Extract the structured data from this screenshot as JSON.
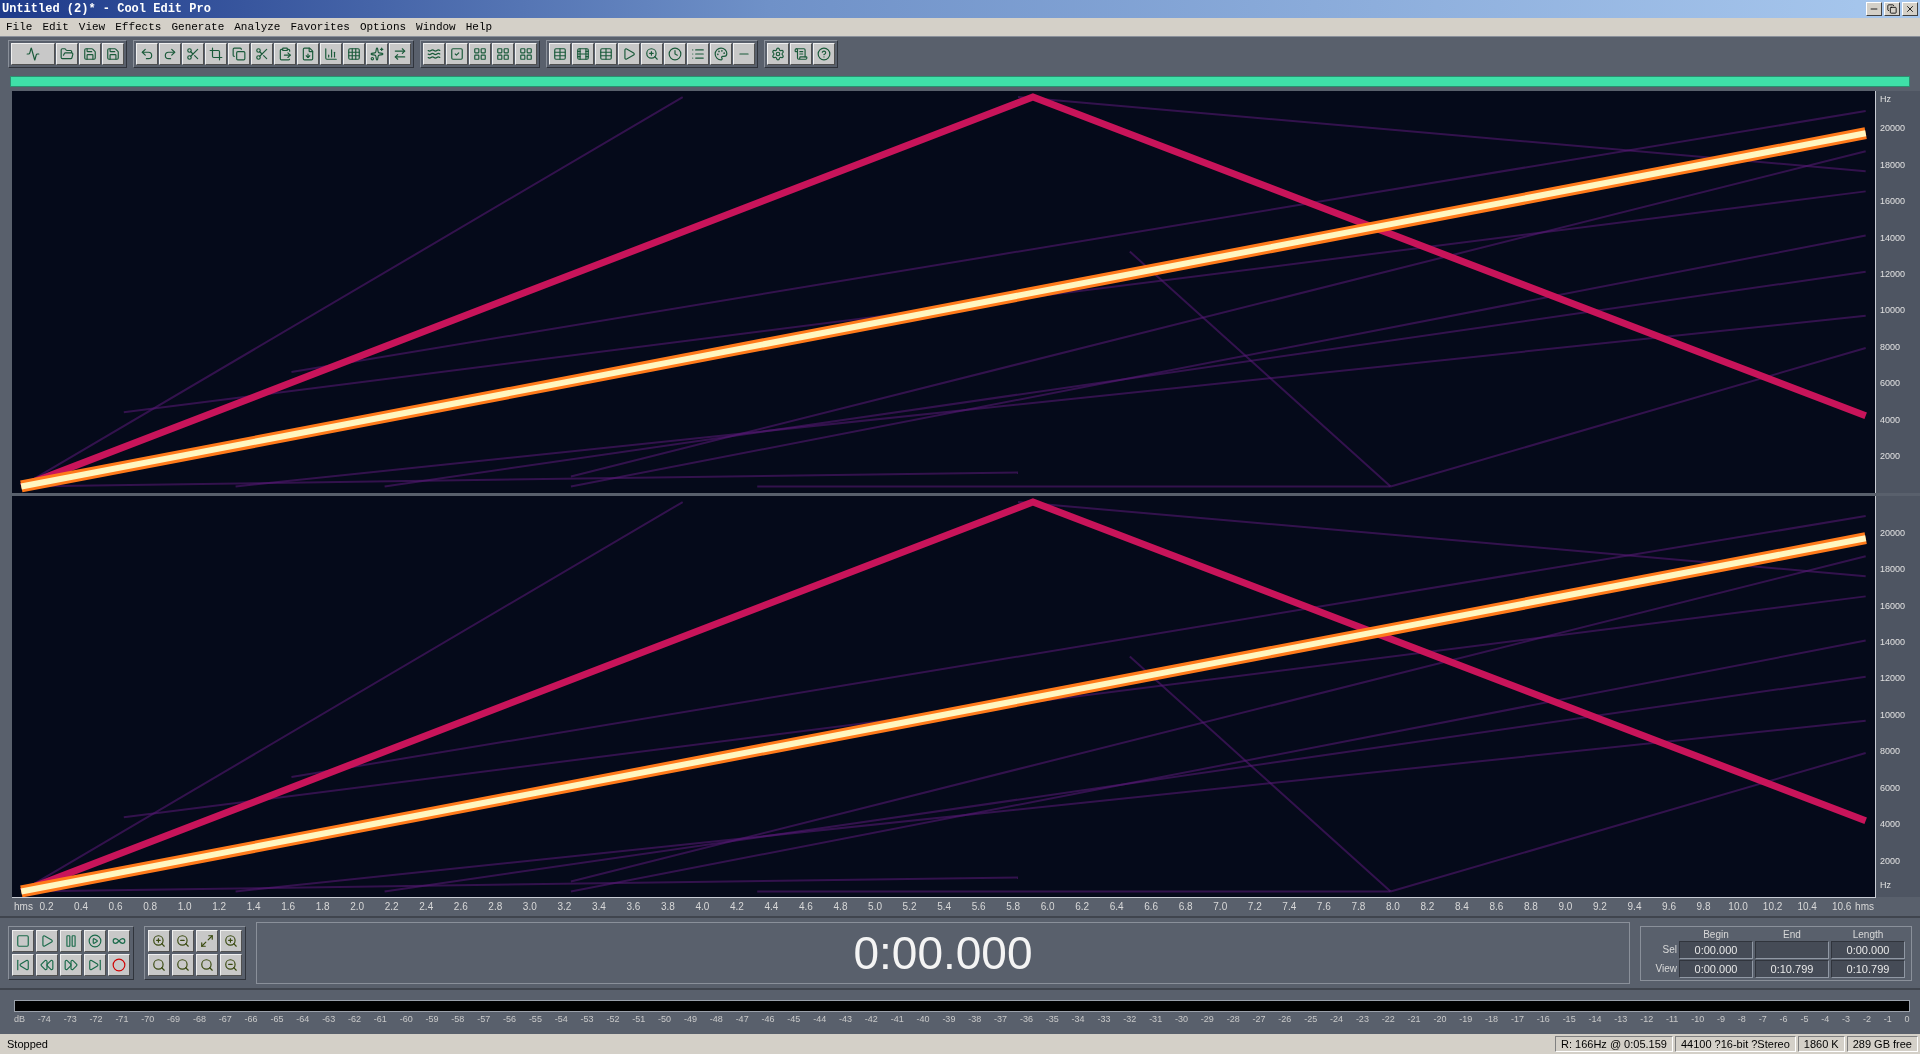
{
  "window": {
    "title": "Untitled (2)* - Cool Edit Pro"
  },
  "menu": [
    "File",
    "Edit",
    "View",
    "Effects",
    "Generate",
    "Analyze",
    "Favorites",
    "Options",
    "Window",
    "Help"
  ],
  "spectrogram": {
    "channels": [
      {
        "freq_labels": [
          {
            "kind": "unit",
            "text": "Hz"
          },
          {
            "kind": "tick",
            "text": "20000"
          },
          {
            "kind": "tick",
            "text": "18000"
          },
          {
            "kind": "tick",
            "text": "16000"
          },
          {
            "kind": "tick",
            "text": "14000"
          },
          {
            "kind": "tick",
            "text": "12000"
          },
          {
            "kind": "tick",
            "text": "10000"
          },
          {
            "kind": "tick",
            "text": "8000"
          },
          {
            "kind": "tick",
            "text": "6000"
          },
          {
            "kind": "tick",
            "text": "4000"
          },
          {
            "kind": "tick",
            "text": "2000"
          }
        ]
      },
      {
        "freq_labels": [
          {
            "kind": "tick",
            "text": "20000"
          },
          {
            "kind": "tick",
            "text": "18000"
          },
          {
            "kind": "tick",
            "text": "16000"
          },
          {
            "kind": "tick",
            "text": "14000"
          },
          {
            "kind": "tick",
            "text": "12000"
          },
          {
            "kind": "tick",
            "text": "10000"
          },
          {
            "kind": "tick",
            "text": "8000"
          },
          {
            "kind": "tick",
            "text": "6000"
          },
          {
            "kind": "tick",
            "text": "4000"
          },
          {
            "kind": "tick",
            "text": "2000"
          },
          {
            "kind": "unit",
            "text": "Hz"
          }
        ]
      }
    ]
  },
  "time_axis": {
    "labels": [
      "hms",
      "0.2",
      "0.4",
      "0.6",
      "0.8",
      "1.0",
      "1.2",
      "1.4",
      "1.6",
      "1.8",
      "2.0",
      "2.2",
      "2.4",
      "2.6",
      "2.8",
      "3.0",
      "3.2",
      "3.4",
      "3.6",
      "3.8",
      "4.0",
      "4.2",
      "4.4",
      "4.6",
      "4.8",
      "5.0",
      "5.2",
      "5.4",
      "5.6",
      "5.8",
      "6.0",
      "6.2",
      "6.4",
      "6.6",
      "6.8",
      "7.0",
      "7.2",
      "7.4",
      "7.6",
      "7.8",
      "8.0",
      "8.2",
      "8.4",
      "8.6",
      "8.8",
      "9.0",
      "9.2",
      "9.4",
      "9.6",
      "9.8",
      "10.0",
      "10.2",
      "10.4",
      "10.6",
      "hms"
    ]
  },
  "time_display": "0:00.000",
  "selection_panel": {
    "columns": [
      "Begin",
      "End",
      "Length"
    ],
    "rows": [
      {
        "label": "Sel",
        "begin": "0:00.000",
        "length": "0:00.000"
      },
      {
        "label": "View",
        "begin": "0:00.000",
        "end": "0:10.799",
        "length": "0:10.799"
      }
    ]
  },
  "level_meter": {
    "labels": [
      "dB",
      "-74",
      "-73",
      "-72",
      "-71",
      "-70",
      "-69",
      "-68",
      "-67",
      "-66",
      "-65",
      "-64",
      "-63",
      "-62",
      "-61",
      "-60",
      "-59",
      "-58",
      "-57",
      "-56",
      "-55",
      "-54",
      "-53",
      "-52",
      "-51",
      "-50",
      "-49",
      "-48",
      "-47",
      "-46",
      "-45",
      "-44",
      "-43",
      "-42",
      "-41",
      "-40",
      "-39",
      "-38",
      "-37",
      "-36",
      "-35",
      "-34",
      "-33",
      "-32",
      "-31",
      "-30",
      "-29",
      "-28",
      "-27",
      "-26",
      "-25",
      "-24",
      "-23",
      "-22",
      "-21",
      "-20",
      "-19",
      "-18",
      "-17",
      "-16",
      "-15",
      "-14",
      "-13",
      "-12",
      "-11",
      "-10",
      "-9",
      "-8",
      "-7",
      "-6",
      "-5",
      "-4",
      "-3",
      "-2",
      "-1",
      "0"
    ]
  },
  "status_bar": [
    "Stopped",
    "R: 166Hz @  0:05.159",
    "44100 ?16-bit ?Stereo",
    "1860 K",
    "289 GB free"
  ]
}
